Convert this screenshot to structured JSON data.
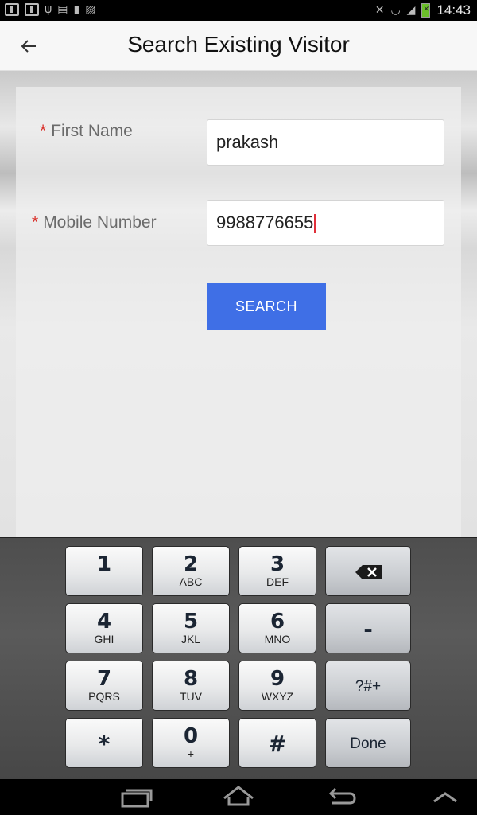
{
  "status_bar": {
    "time": "14:43",
    "left_icons": [
      "notification-1-icon",
      "notification-1-icon",
      "usb-icon",
      "keyboard-icon",
      "sd-card-icon",
      "image-icon"
    ],
    "right_icons": [
      "mute-icon",
      "wifi-icon",
      "signal-icon",
      "battery-icon"
    ]
  },
  "header": {
    "back_icon": "back-arrow-icon",
    "title": "Search Existing Visitor"
  },
  "form": {
    "first_name": {
      "required_mark": "*",
      "label": "First Name",
      "value": "prakash"
    },
    "mobile_number": {
      "required_mark": "*",
      "label": "Mobile Number",
      "value": "9988776655"
    },
    "search_button": "SEARCH"
  },
  "keyboard": {
    "keys": [
      {
        "main": "1",
        "sub": ""
      },
      {
        "main": "2",
        "sub": "ABC"
      },
      {
        "main": "3",
        "sub": "DEF"
      },
      {
        "main": "4",
        "sub": "GHI"
      },
      {
        "main": "5",
        "sub": "JKL"
      },
      {
        "main": "6",
        "sub": "MNO"
      },
      {
        "main": "7",
        "sub": "PQRS"
      },
      {
        "main": "8",
        "sub": "TUV"
      },
      {
        "main": "9",
        "sub": "WXYZ"
      },
      {
        "main": "*",
        "sub": ""
      },
      {
        "main": "0",
        "sub": "+"
      },
      {
        "main": "#",
        "sub": ""
      }
    ],
    "function_keys": {
      "backspace": "backspace-icon",
      "minus": "-",
      "symbols": "?#+",
      "done": "Done"
    }
  },
  "nav_bar": {
    "icons": [
      "recent-apps-icon",
      "home-icon",
      "back-icon",
      "up-chevron-icon"
    ]
  }
}
